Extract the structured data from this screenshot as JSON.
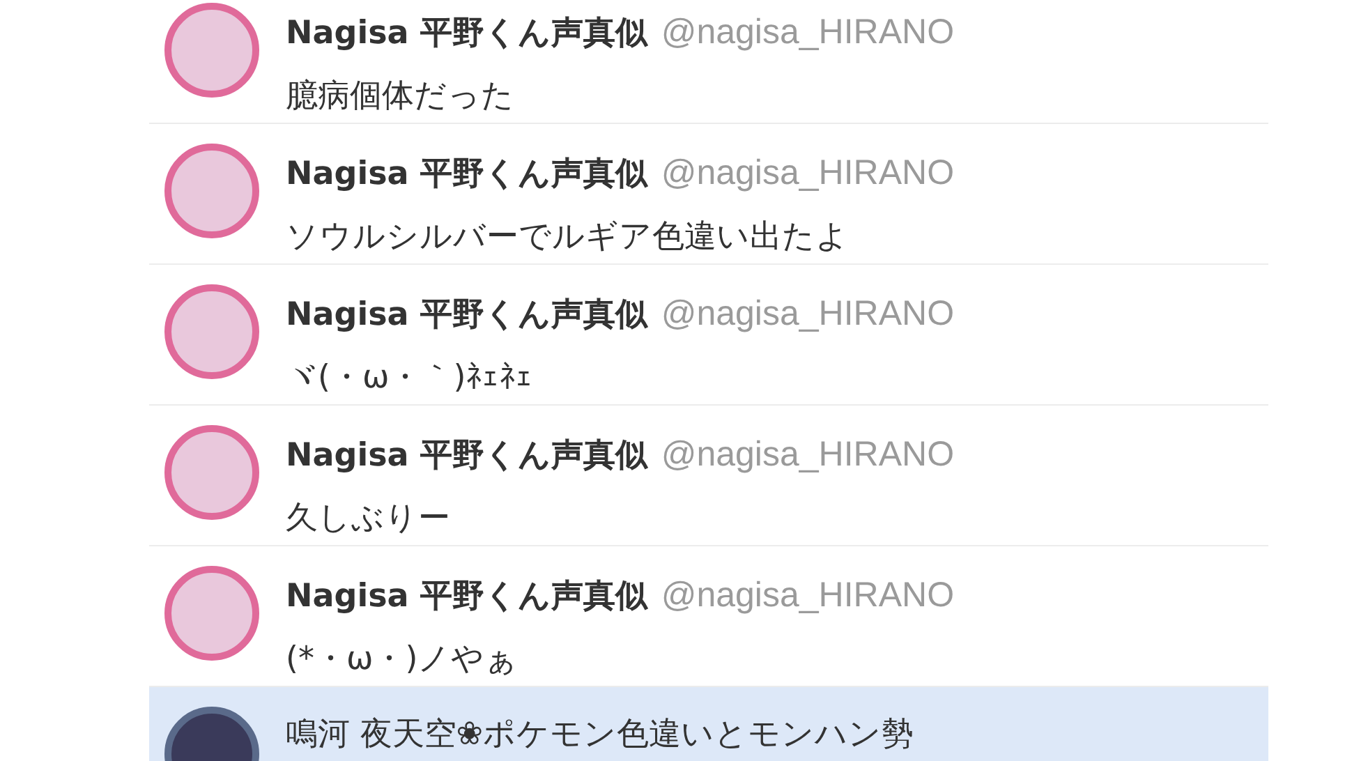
{
  "tweets": [
    {
      "name": "Nagisa 平野くん声真似",
      "handle": "@nagisa_HIRANO",
      "text": "臆病個体だった",
      "selected": false
    },
    {
      "name": "Nagisa 平野くん声真似",
      "handle": "@nagisa_HIRANO",
      "text": "ソウルシルバーでルギア色違い出たよ",
      "selected": false
    },
    {
      "name": "Nagisa 平野くん声真似",
      "handle": "@nagisa_HIRANO",
      "text": "ヾ(・ω・｀)ﾈｪﾈｪ",
      "selected": false
    },
    {
      "name": "Nagisa 平野くん声真似",
      "handle": "@nagisa_HIRANO",
      "text": "久しぶりー",
      "selected": false
    },
    {
      "name": "Nagisa 平野くん声真似",
      "handle": "@nagisa_HIRANO",
      "text": "(*・ω・)ノやぁ",
      "selected": false
    },
    {
      "name": "鳴河 夜天空❀ポケモン色違いとモンハン勢",
      "selected": true
    }
  ]
}
